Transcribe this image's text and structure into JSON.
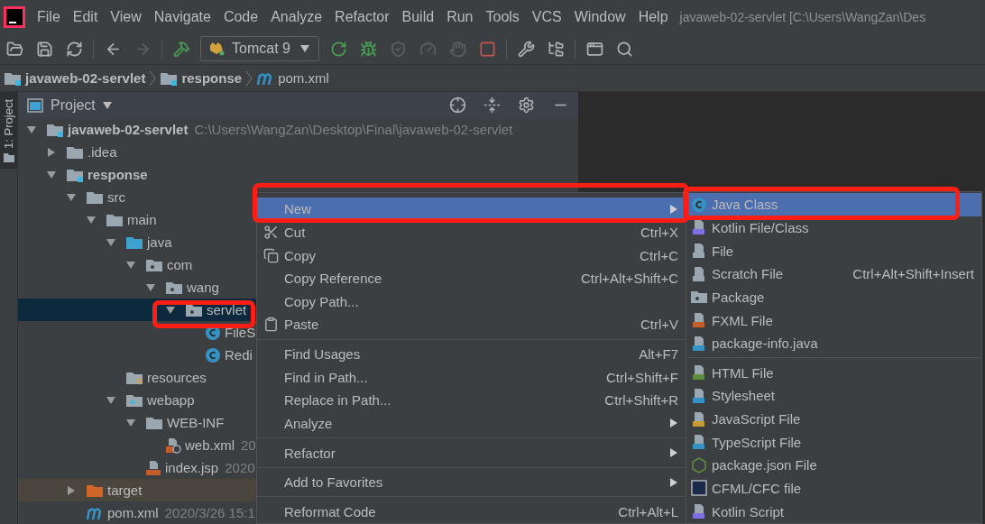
{
  "menubar": {
    "items": [
      "File",
      "Edit",
      "View",
      "Navigate",
      "Code",
      "Analyze",
      "Refactor",
      "Build",
      "Run",
      "Tools",
      "VCS",
      "Window",
      "Help"
    ],
    "title": "javaweb-02-servlet [C:\\Users\\WangZan\\Des"
  },
  "toolbar": {
    "items": [
      {
        "kind": "open",
        "disabled": false
      },
      {
        "kind": "save",
        "disabled": false
      },
      {
        "kind": "sync",
        "disabled": false
      },
      {
        "kind": "sep"
      },
      {
        "kind": "back",
        "disabled": false
      },
      {
        "kind": "forward",
        "disabled": true
      },
      {
        "kind": "sep"
      },
      {
        "kind": "build",
        "disabled": false
      },
      {
        "kind": "config",
        "label": "Tomcat 9"
      },
      {
        "kind": "rerun",
        "disabled": false
      },
      {
        "kind": "debug",
        "disabled": false
      },
      {
        "kind": "coverage",
        "disabled": true
      },
      {
        "kind": "profile",
        "disabled": true
      },
      {
        "kind": "attach",
        "disabled": true
      },
      {
        "kind": "stop",
        "disabled": false
      },
      {
        "kind": "sep"
      },
      {
        "kind": "wrench",
        "disabled": false
      },
      {
        "kind": "structure",
        "disabled": false
      },
      {
        "kind": "sep"
      },
      {
        "kind": "terminal",
        "disabled": false
      },
      {
        "kind": "search",
        "disabled": false
      }
    ]
  },
  "breadcrumbs": [
    {
      "label": "javaweb-02-servlet",
      "kind": "module"
    },
    {
      "label": "response",
      "kind": "module"
    },
    {
      "label": "pom.xml",
      "kind": "maven"
    }
  ],
  "side_tab": {
    "label": "1: Project",
    "selected": true
  },
  "project_panel": {
    "title": "Project",
    "tree": [
      {
        "label": "javaweb-02-servlet",
        "kind": "module",
        "note": "C:\\Users\\WangZan\\Desktop\\Final\\javaweb-02-servlet",
        "expanded": true,
        "selected": false,
        "children": [
          {
            "label": ".idea",
            "kind": "folder",
            "expanded": false,
            "selected": false
          },
          {
            "label": "response",
            "kind": "module",
            "expanded": true,
            "selected": false,
            "children": [
              {
                "label": "src",
                "kind": "folder",
                "expanded": true,
                "selected": false,
                "children": [
                  {
                    "label": "main",
                    "kind": "folder",
                    "expanded": true,
                    "selected": false,
                    "children": [
                      {
                        "label": "java",
                        "kind": "source",
                        "expanded": true,
                        "selected": false,
                        "children": [
                          {
                            "label": "com",
                            "kind": "package",
                            "expanded": true,
                            "selected": false,
                            "children": [
                              {
                                "label": "wang",
                                "kind": "package",
                                "expanded": true,
                                "selected": false,
                                "children": [
                                  {
                                    "label": "servlet",
                                    "kind": "package",
                                    "expanded": true,
                                    "selected": true,
                                    "children": [
                                      {
                                        "label": "FileS",
                                        "kind": "class",
                                        "selected": false
                                      },
                                      {
                                        "label": "Redi",
                                        "kind": "class",
                                        "selected": false
                                      }
                                    ]
                                  }
                                ]
                              }
                            ]
                          }
                        ]
                      },
                      {
                        "label": "resources",
                        "kind": "resources",
                        "selected": false
                      },
                      {
                        "label": "webapp",
                        "kind": "webapp",
                        "expanded": true,
                        "selected": false,
                        "children": [
                          {
                            "label": "WEB-INF",
                            "kind": "folder",
                            "expanded": true,
                            "selected": false,
                            "children": [
                              {
                                "label": "web.xml",
                                "kind": "xml",
                                "note": "20",
                                "selected": false
                              }
                            ]
                          },
                          {
                            "label": "index.jsp",
                            "kind": "jsp",
                            "note": "2020",
                            "selected": false
                          }
                        ]
                      }
                    ]
                  }
                ]
              },
              {
                "label": "target",
                "kind": "excluded",
                "expanded": false,
                "selected": false
              },
              {
                "label": "pom.xml",
                "kind": "maven",
                "note": "2020/3/26 15:1",
                "selected": false
              }
            ]
          }
        ]
      }
    ]
  },
  "context_menu": {
    "groups": [
      [
        {
          "label": "New",
          "kind": "plain",
          "submenu": true,
          "selected": true
        },
        {
          "label": "Cut",
          "kind": "cut",
          "shortcut": "Ctrl+X",
          "selected": false
        },
        {
          "label": "Copy",
          "kind": "copy",
          "shortcut": "Ctrl+C",
          "selected": false
        },
        {
          "label": "Copy Reference",
          "kind": "plain",
          "shortcut": "Ctrl+Alt+Shift+C",
          "selected": false
        },
        {
          "label": "Copy Path...",
          "kind": "plain",
          "selected": false
        },
        {
          "label": "Paste",
          "kind": "paste",
          "shortcut": "Ctrl+V",
          "selected": false
        }
      ],
      [
        {
          "label": "Find Usages",
          "kind": "plain",
          "shortcut": "Alt+F7",
          "selected": false
        },
        {
          "label": "Find in Path...",
          "kind": "plain",
          "shortcut": "Ctrl+Shift+F",
          "selected": false
        },
        {
          "label": "Replace in Path...",
          "kind": "plain",
          "shortcut": "Ctrl+Shift+R",
          "selected": false
        },
        {
          "label": "Analyze",
          "kind": "plain",
          "submenu": true,
          "selected": false
        }
      ],
      [
        {
          "label": "Refactor",
          "kind": "plain",
          "submenu": true,
          "selected": false
        }
      ],
      [
        {
          "label": "Add to Favorites",
          "kind": "plain",
          "submenu": true,
          "selected": false
        }
      ],
      [
        {
          "label": "Reformat Code",
          "kind": "plain",
          "shortcut": "Ctrl+Alt+L",
          "selected": false
        }
      ]
    ]
  },
  "new_submenu": {
    "groups": [
      [
        {
          "label": "Java Class",
          "kind": "class",
          "selected": true
        },
        {
          "label": "Kotlin File/Class",
          "kind": "kotlin",
          "selected": false
        },
        {
          "label": "File",
          "kind": "file",
          "selected": false
        },
        {
          "label": "Scratch File",
          "kind": "scratch",
          "shortcut": "Ctrl+Alt+Shift+Insert",
          "selected": false
        },
        {
          "label": "Package",
          "kind": "package",
          "selected": false
        },
        {
          "label": "FXML File",
          "kind": "fxml",
          "selected": false
        },
        {
          "label": "package-info.java",
          "kind": "java",
          "selected": false
        }
      ],
      [
        {
          "label": "HTML File",
          "kind": "html",
          "selected": false
        },
        {
          "label": "Stylesheet",
          "kind": "css",
          "selected": false
        },
        {
          "label": "JavaScript File",
          "kind": "js",
          "selected": false
        },
        {
          "label": "TypeScript File",
          "kind": "ts",
          "selected": false
        },
        {
          "label": "package.json File",
          "kind": "node",
          "selected": false
        },
        {
          "label": "CFML/CFC file",
          "kind": "cfml",
          "selected": false
        },
        {
          "label": "Kotlin Script",
          "kind": "kotlin",
          "selected": false
        }
      ]
    ]
  }
}
